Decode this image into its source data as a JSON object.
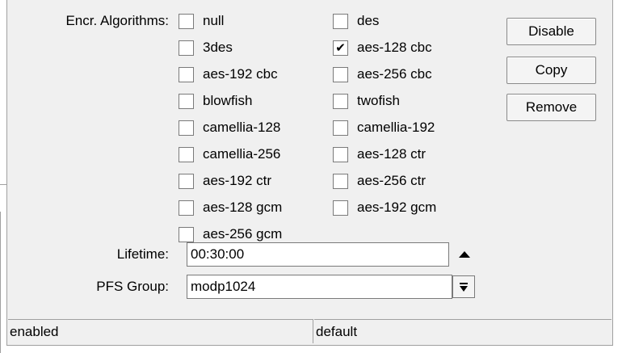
{
  "form": {
    "encr_label": "Encr. Algorithms:",
    "lifetime_label": "Lifetime:",
    "lifetime_value": "00:30:00",
    "pfs_label": "PFS Group:",
    "pfs_value": "modp1024"
  },
  "algorithms": [
    {
      "label": "null",
      "checked": false
    },
    {
      "label": "des",
      "checked": false
    },
    {
      "label": "3des",
      "checked": false
    },
    {
      "label": "aes-128 cbc",
      "checked": true
    },
    {
      "label": "aes-192 cbc",
      "checked": false
    },
    {
      "label": "aes-256 cbc",
      "checked": false
    },
    {
      "label": "blowfish",
      "checked": false
    },
    {
      "label": "twofish",
      "checked": false
    },
    {
      "label": "camellia-128",
      "checked": false
    },
    {
      "label": "camellia-192",
      "checked": false
    },
    {
      "label": "camellia-256",
      "checked": false
    },
    {
      "label": "aes-128 ctr",
      "checked": false
    },
    {
      "label": "aes-192 ctr",
      "checked": false
    },
    {
      "label": "aes-256 ctr",
      "checked": false
    },
    {
      "label": "aes-128 gcm",
      "checked": false
    },
    {
      "label": "aes-192 gcm",
      "checked": false
    },
    {
      "label": "aes-256 gcm",
      "checked": false
    }
  ],
  "buttons": {
    "disable": "Disable",
    "copy": "Copy",
    "remove": "Remove"
  },
  "icons": {
    "lifetime_arrow": "triangle-up-icon",
    "pfs_dropdown": "dropdown-arrow-icon",
    "check": "checkmark-icon"
  },
  "status_bar": {
    "left": "enabled",
    "right": "default"
  }
}
